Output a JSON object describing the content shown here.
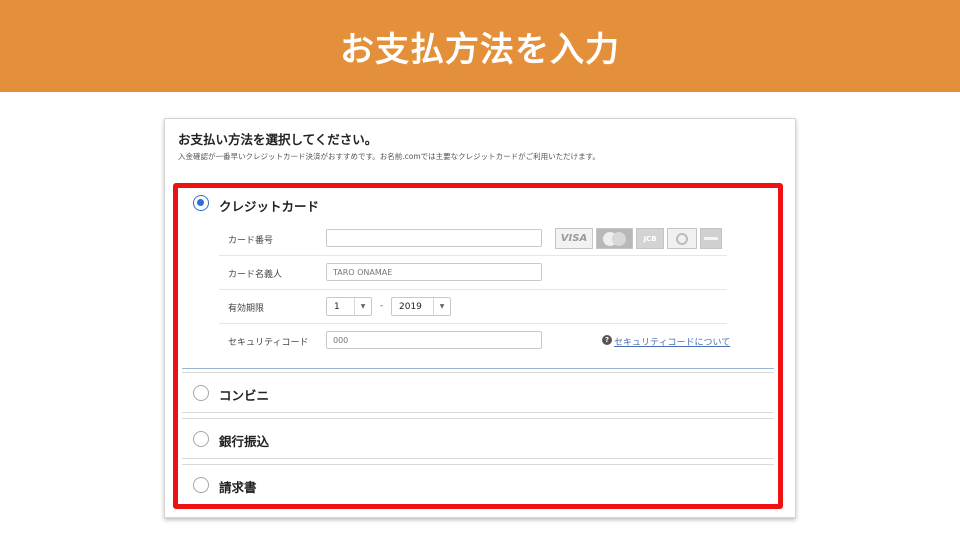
{
  "banner": {
    "title": "お支払方法を入力"
  },
  "card": {
    "heading": "お支払い方法を選択してください。",
    "subtext": "入金確認が一番早いクレジットカード決済がおすすめです。お名前.comでは主要なクレジットカードがご利用いただけます。"
  },
  "payment_options": {
    "credit": {
      "label": "クレジットカード",
      "selected": true
    },
    "convenience": {
      "label": "コンビニ",
      "selected": false
    },
    "bank": {
      "label": "銀行振込",
      "selected": false
    },
    "invoice": {
      "label": "請求書",
      "selected": false
    }
  },
  "credit_form": {
    "card_number_label": "カード番号",
    "card_number_value": "",
    "card_brands": [
      {
        "name": "VISA",
        "icon": "visa-logo-icon"
      },
      {
        "name": "MasterCard",
        "icon": "mastercard-logo-icon"
      },
      {
        "name": "JCB",
        "icon": "jcb-logo-icon",
        "text": "JCB"
      },
      {
        "name": "Diners",
        "icon": "diners-logo-icon"
      },
      {
        "name": "AMEX",
        "icon": "amex-logo-icon"
      }
    ],
    "visa_text": "VISA",
    "jcb_text": "JCB",
    "holder_label": "カード名義人",
    "holder_placeholder": "TARO ONAMAE",
    "expiry_label": "有効期限",
    "expiry_month": "1",
    "expiry_separator": "-",
    "expiry_year": "2019",
    "security_label": "セキュリティコード",
    "security_placeholder": "000",
    "security_help_link": "セキュリティコードについて",
    "help_icon_glyph": "?"
  },
  "colors": {
    "banner": "#e48f3a",
    "highlight_border": "#ee1111",
    "radio_selected": "#2f6fd1",
    "link": "#4a6fb5"
  }
}
